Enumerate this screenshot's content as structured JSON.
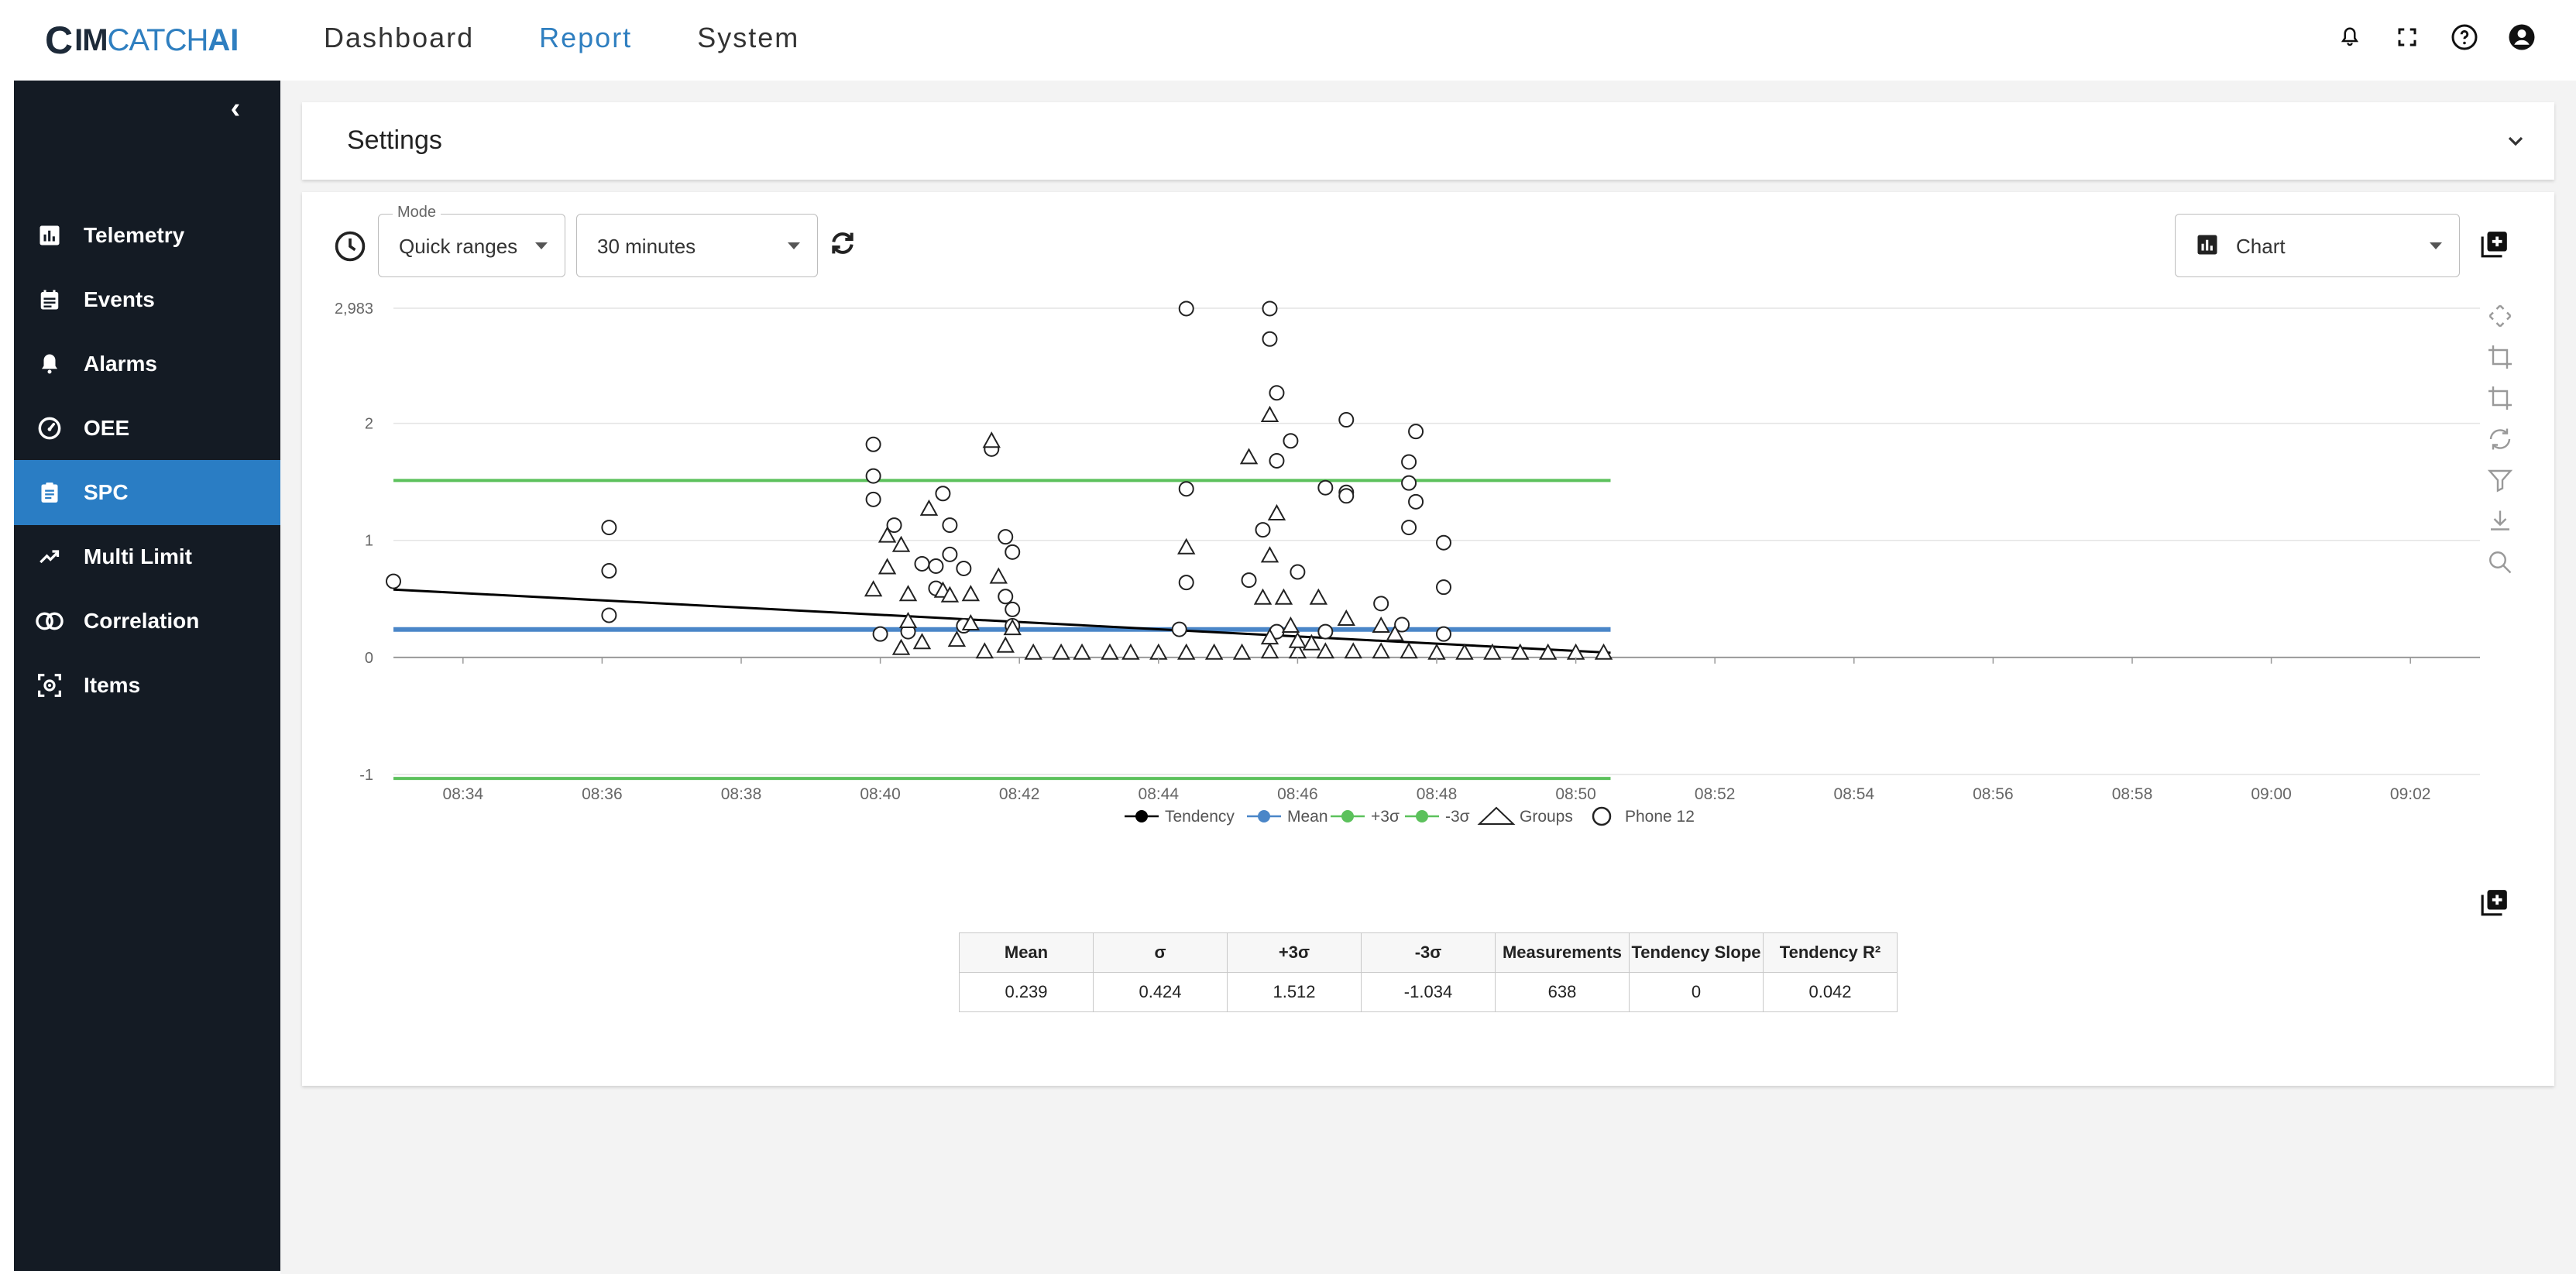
{
  "logo": {
    "mark": "C",
    "part1": "IM",
    "part2": "CATCH",
    "part3": "AI"
  },
  "topnav": {
    "items": [
      {
        "label": "Dashboard",
        "active": false
      },
      {
        "label": "Report",
        "active": true
      },
      {
        "label": "System",
        "active": false
      }
    ]
  },
  "top_icons": [
    "bell-icon",
    "fullscreen-icon",
    "help-icon",
    "account-icon"
  ],
  "sidebar": {
    "collapse_glyph": "‹",
    "items": [
      {
        "label": "Telemetry",
        "icon": "bar-chart-icon",
        "active": false
      },
      {
        "label": "Events",
        "icon": "calendar-icon",
        "active": false
      },
      {
        "label": "Alarms",
        "icon": "alarm-bell-icon",
        "active": false
      },
      {
        "label": "OEE",
        "icon": "gauge-icon",
        "active": false
      },
      {
        "label": "SPC",
        "icon": "clipboard-icon",
        "active": true
      },
      {
        "label": "Multi Limit",
        "icon": "trending-up-icon",
        "active": false
      },
      {
        "label": "Correlation",
        "icon": "overlap-circles-icon",
        "active": false
      },
      {
        "label": "Items",
        "icon": "scan-icon",
        "active": false
      }
    ]
  },
  "settings": {
    "title": "Settings"
  },
  "controls": {
    "mode_label": "Mode",
    "mode_value": "Quick ranges",
    "range_value": "30 minutes",
    "view_value": "Chart"
  },
  "colors": {
    "accent": "#2f7fc0",
    "sidebar_bg": "#141b24",
    "sidebar_active": "#2a7dc4",
    "mean": "#4a86c8",
    "sigma": "#5cc15c",
    "tendency": "#000000"
  },
  "chart_data": {
    "type": "scatter",
    "title": "",
    "ylim": [
      -1,
      2.983
    ],
    "yticks": [
      "2,983",
      "2",
      "1",
      "0",
      "-1"
    ],
    "xticks": [
      "08:34",
      "08:36",
      "08:38",
      "08:40",
      "08:42",
      "08:44",
      "08:46",
      "08:48",
      "08:50",
      "08:52",
      "08:54",
      "08:56",
      "08:58",
      "09:00",
      "09:02"
    ],
    "legend": [
      "Tendency",
      "Mean",
      "+3σ",
      "-3σ",
      "Groups",
      "Phone 12"
    ],
    "lines": {
      "mean": {
        "x": [
          "08:33",
          "08:50.5"
        ],
        "y": [
          0.239,
          0.239
        ]
      },
      "plus3sigma": {
        "x": [
          "08:33",
          "08:50.5"
        ],
        "y": [
          1.512,
          1.512
        ]
      },
      "minus3sigma": {
        "x": [
          "08:33",
          "08:50.5"
        ],
        "y": [
          -1.034,
          -1.034
        ]
      },
      "tendency": {
        "x": [
          "08:33",
          "08:50.5"
        ],
        "y": [
          0.58,
          0.04
        ]
      }
    },
    "phone12": [
      [
        33.0,
        0.65
      ],
      [
        36.1,
        1.11
      ],
      [
        36.1,
        0.74
      ],
      [
        36.1,
        0.36
      ],
      [
        39.9,
        1.82
      ],
      [
        39.9,
        1.55
      ],
      [
        39.9,
        1.35
      ],
      [
        40.2,
        1.13
      ],
      [
        40.0,
        0.2
      ],
      [
        40.4,
        0.22
      ],
      [
        40.6,
        0.8
      ],
      [
        40.8,
        0.78
      ],
      [
        40.9,
        1.4
      ],
      [
        40.8,
        0.59
      ],
      [
        41.0,
        1.13
      ],
      [
        41.0,
        0.88
      ],
      [
        41.2,
        0.76
      ],
      [
        41.2,
        0.27
      ],
      [
        41.6,
        1.78
      ],
      [
        41.8,
        1.03
      ],
      [
        41.9,
        0.9
      ],
      [
        41.8,
        0.52
      ],
      [
        41.9,
        0.41
      ],
      [
        41.9,
        0.27
      ],
      [
        44.4,
        2.98
      ],
      [
        44.4,
        1.44
      ],
      [
        44.4,
        0.64
      ],
      [
        44.3,
        0.24
      ],
      [
        45.3,
        0.66
      ],
      [
        45.5,
        1.09
      ],
      [
        45.6,
        2.98
      ],
      [
        45.6,
        2.72
      ],
      [
        45.7,
        2.26
      ],
      [
        45.7,
        1.68
      ],
      [
        45.9,
        1.85
      ],
      [
        46.0,
        0.73
      ],
      [
        45.7,
        0.22
      ],
      [
        46.4,
        1.45
      ],
      [
        46.7,
        2.03
      ],
      [
        46.7,
        1.41
      ],
      [
        46.7,
        1.38
      ],
      [
        46.4,
        0.22
      ],
      [
        47.2,
        0.46
      ],
      [
        47.5,
        0.28
      ],
      [
        47.7,
        1.93
      ],
      [
        47.6,
        1.67
      ],
      [
        47.6,
        1.49
      ],
      [
        47.7,
        1.33
      ],
      [
        47.6,
        1.11
      ],
      [
        48.1,
        0.98
      ],
      [
        48.1,
        0.6
      ],
      [
        48.1,
        0.2
      ]
    ],
    "groups": [
      [
        39.9,
        0.58
      ],
      [
        40.1,
        1.04
      ],
      [
        40.1,
        0.77
      ],
      [
        40.3,
        0.96
      ],
      [
        40.4,
        0.54
      ],
      [
        40.4,
        0.31
      ],
      [
        40.6,
        0.13
      ],
      [
        40.7,
        1.27
      ],
      [
        40.9,
        0.57
      ],
      [
        41.0,
        0.53
      ],
      [
        41.3,
        0.54
      ],
      [
        41.3,
        0.29
      ],
      [
        41.6,
        1.85
      ],
      [
        41.7,
        0.69
      ],
      [
        41.9,
        0.25
      ],
      [
        40.3,
        0.08
      ],
      [
        41.1,
        0.15
      ],
      [
        41.5,
        0.05
      ],
      [
        41.8,
        0.1
      ],
      [
        42.2,
        0.04
      ],
      [
        42.6,
        0.04
      ],
      [
        42.9,
        0.04
      ],
      [
        43.3,
        0.04
      ],
      [
        43.6,
        0.04
      ],
      [
        44.0,
        0.04
      ],
      [
        44.4,
        0.04
      ],
      [
        44.8,
        0.04
      ],
      [
        45.2,
        0.04
      ],
      [
        45.6,
        0.05
      ],
      [
        46.0,
        0.05
      ],
      [
        46.4,
        0.05
      ],
      [
        46.8,
        0.05
      ],
      [
        47.2,
        0.05
      ],
      [
        47.6,
        0.05
      ],
      [
        48.0,
        0.04
      ],
      [
        48.4,
        0.04
      ],
      [
        48.8,
        0.04
      ],
      [
        49.2,
        0.04
      ],
      [
        49.6,
        0.04
      ],
      [
        50.0,
        0.04
      ],
      [
        50.4,
        0.04
      ],
      [
        44.4,
        0.94
      ],
      [
        45.3,
        1.71
      ],
      [
        45.6,
        2.07
      ],
      [
        45.7,
        1.23
      ],
      [
        45.6,
        0.87
      ],
      [
        45.5,
        0.51
      ],
      [
        45.8,
        0.51
      ],
      [
        45.9,
        0.27
      ],
      [
        45.6,
        0.17
      ],
      [
        46.3,
        0.51
      ],
      [
        46.7,
        0.33
      ],
      [
        47.2,
        0.27
      ],
      [
        47.4,
        0.2
      ],
      [
        46.0,
        0.14
      ],
      [
        46.2,
        0.12
      ]
    ]
  },
  "stats": {
    "headers": [
      "Mean",
      "σ",
      "+3σ",
      "-3σ",
      "Measurements",
      "Tendency Slope",
      "Tendency R²"
    ],
    "values": [
      "0.239",
      "0.424",
      "1.512",
      "-1.034",
      "638",
      "0",
      "0.042"
    ]
  }
}
